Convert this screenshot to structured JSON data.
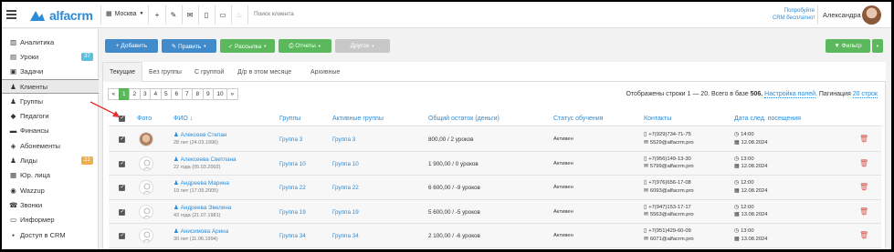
{
  "topbar": {
    "brand": "alfacrm",
    "city": "Москва",
    "search_placeholder": "Поиск клиента",
    "promo_line1": "Попробуйте",
    "promo_line2": "CRM бесплатно!",
    "user_name": "Александра"
  },
  "sidebar": {
    "items": [
      {
        "label": "Аналитика",
        "icon": "chart-icon"
      },
      {
        "label": "Уроки",
        "icon": "calendar-icon",
        "badge": "37",
        "badge_color": "#5bc0de"
      },
      {
        "label": "Задачи",
        "icon": "tasks-icon"
      },
      {
        "label": "Клиенты",
        "icon": "user-icon"
      },
      {
        "label": "Группы",
        "icon": "users-icon"
      },
      {
        "label": "Педагоги",
        "icon": "graduation-icon"
      },
      {
        "label": "Финансы",
        "icon": "wallet-icon"
      },
      {
        "label": "Абонементы",
        "icon": "tag-icon"
      },
      {
        "label": "Лиды",
        "icon": "user-plus-icon",
        "badge": "22",
        "badge_color": "#f0ad4e"
      },
      {
        "label": "Юр. лица",
        "icon": "building-icon"
      },
      {
        "label": "Wazzup",
        "icon": "whatsapp-icon"
      },
      {
        "label": "Звонки",
        "icon": "phone-icon"
      },
      {
        "label": "Информер",
        "icon": "monitor-icon"
      },
      {
        "label": "Доступ в CRM",
        "icon": "lock-icon"
      }
    ]
  },
  "actions": {
    "add": "+ Добавить",
    "edit": "✎ Править",
    "mailing": "✓ Рассылка",
    "reports": "⎙ Отчеты",
    "other": "Другое",
    "filter": "Фильтр",
    "colors": {
      "primary": "#428bca",
      "success": "#5cb85c",
      "disabled": "#c8c8c8"
    }
  },
  "tabs": [
    "Текущие",
    "Без группы",
    "С группой",
    "Д/р в этом месяце",
    "Архивные"
  ],
  "pagination": {
    "pages": [
      "«",
      "1",
      "2",
      "3",
      "4",
      "5",
      "6",
      "7",
      "8",
      "9",
      "10",
      "»"
    ],
    "info_prefix": "Отображены строки 1 — 20. Всего в базе",
    "total": "506.",
    "settings_link": "Настройка полей",
    "per_page_label": "Пагинация",
    "per_page_value": "20 строк"
  },
  "table": {
    "headers": [
      "Фото",
      "ФИО ↓",
      "Группы",
      "Активные группы",
      "Общий остаток (деньги)",
      "Статус обучения",
      "Контакты",
      "Дата след. посещения"
    ],
    "rows": [
      {
        "name": "Алексеев Степан",
        "age": "28 лет (24.03.1996)",
        "group": "Группа 3",
        "active_group": "Группа 3",
        "balance": "800,00 / 2 уроков",
        "status": "Активен",
        "phone": "+7(929)734-71-75",
        "email": "5529@alfacrm.pro",
        "time": "14:00",
        "date": "12.08.2024"
      },
      {
        "name": "Алексеева Светлана",
        "age": "22 года (05.03.2002)",
        "group": "Группа 10",
        "active_group": "Группа 10",
        "balance": "1 900,00 / 0 уроков",
        "status": "Активен",
        "phone": "+7(956)149-13-30",
        "email": "5799@alfacrm.pro",
        "time": "13:00",
        "date": "12.08.2024"
      },
      {
        "name": "Андреева Марина",
        "age": "19 лет (17.05.2005)",
        "group": "Группа 22",
        "active_group": "Группа 22",
        "balance": "6 600,00 / -9 уроков",
        "status": "Активен",
        "phone": "+7(976)656-17-08",
        "email": "6093@alfacrm.pro",
        "time": "12:00",
        "date": "12.08.2024"
      },
      {
        "name": "Андреева Эвелина",
        "age": "43 года (21.07.1981)",
        "group": "Группа 19",
        "active_group": "Группа 19",
        "balance": "5 600,00 / -5 уроков",
        "status": "Активен",
        "phone": "+7(947)153-17-17",
        "email": "5563@alfacrm.pro",
        "time": "12:00",
        "date": "13.08.2024"
      },
      {
        "name": "Анисимова Арина",
        "age": "30 лет (11.06.1994)",
        "group": "Группа 34",
        "active_group": "Группа 34",
        "balance": "2 100,00 / -6 уроков",
        "status": "Активен",
        "phone": "+7(951)429-60-09",
        "email": "6071@alfacrm.pro",
        "time": "13:00",
        "date": "13.08.2024"
      }
    ]
  }
}
